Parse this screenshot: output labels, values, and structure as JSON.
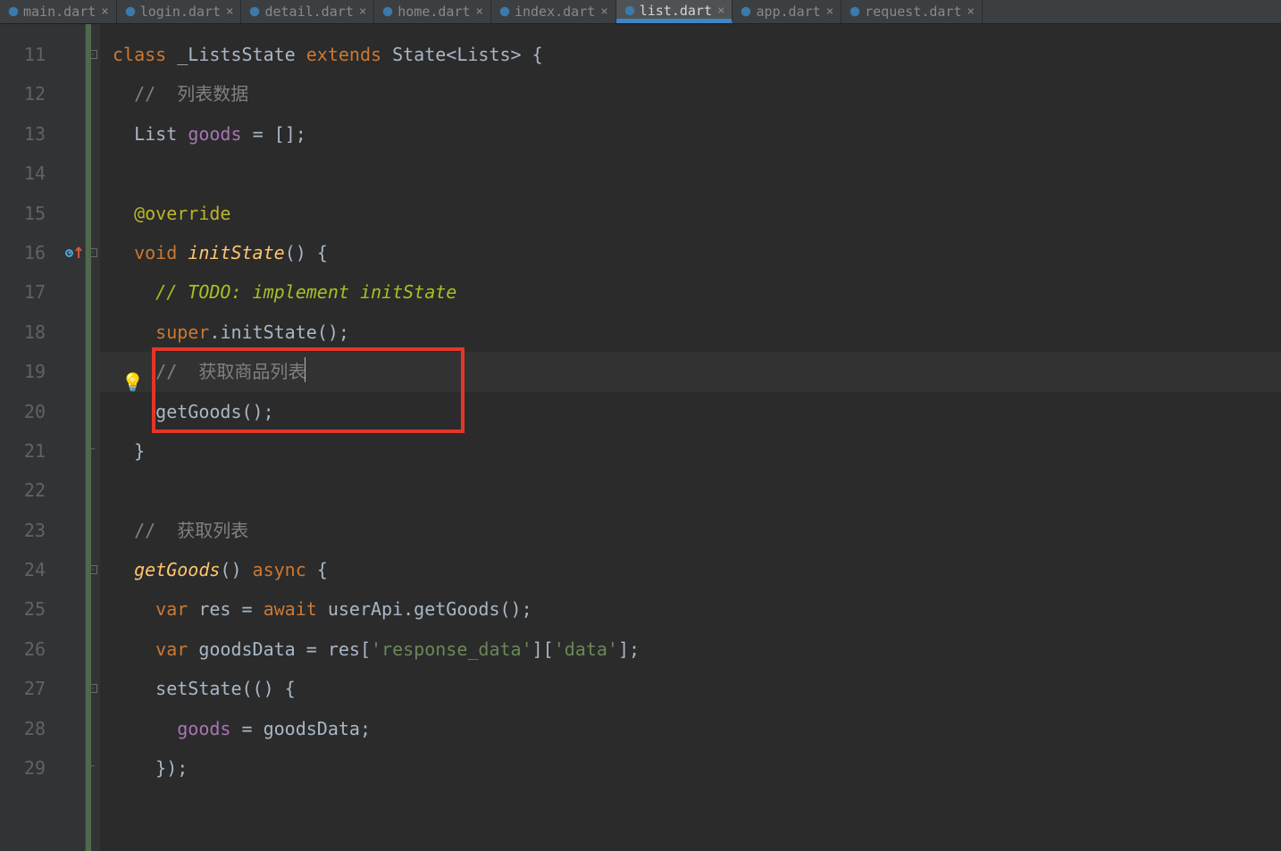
{
  "tabs": [
    {
      "name": "main.dart",
      "active": false
    },
    {
      "name": "login.dart",
      "active": false
    },
    {
      "name": "detail.dart",
      "active": false
    },
    {
      "name": "home.dart",
      "active": false
    },
    {
      "name": "index.dart",
      "active": false
    },
    {
      "name": "list.dart",
      "active": true
    },
    {
      "name": "app.dart",
      "active": false
    },
    {
      "name": "request.dart",
      "active": false
    }
  ],
  "lineStart": 11,
  "lines": {
    "l11": {
      "seg": [
        "class ",
        "_ListsState ",
        "extends ",
        "State<Lists> {"
      ]
    },
    "l12": "  //  列表数据",
    "l13": {
      "type": "List",
      "name": "goods",
      "eq": " = [];"
    },
    "l15": "  @override",
    "l16": {
      "kw": "void ",
      "fn": "initState",
      "rest": "() {"
    },
    "l17": "    // TODO: implement initState",
    "l18": {
      "super": "super",
      "dot": ".",
      "call": "initState",
      "rest": "();"
    },
    "l19": "    //  获取商品列表",
    "l20": {
      "call": "getGoods",
      "rest": "();"
    },
    "l21": "  }",
    "l23": "  //  获取列表",
    "l24": {
      "fn": "getGoods",
      "paren": "() ",
      "kw": "async ",
      "brace": "{"
    },
    "l25": {
      "kw": "var ",
      "name": "res = ",
      "aw": "await ",
      "rest": "userApi.getGoods();"
    },
    "l26": {
      "kw": "var ",
      "name": "goodsData = res[",
      "s1": "'response_data'",
      "mid": "][",
      "s2": "'data'",
      "end": "];"
    },
    "l27": {
      "call": "setState",
      "rest": "(() {"
    },
    "l28": {
      "name": "goods",
      "rest": " = goodsData;"
    },
    "l29": "    });"
  }
}
